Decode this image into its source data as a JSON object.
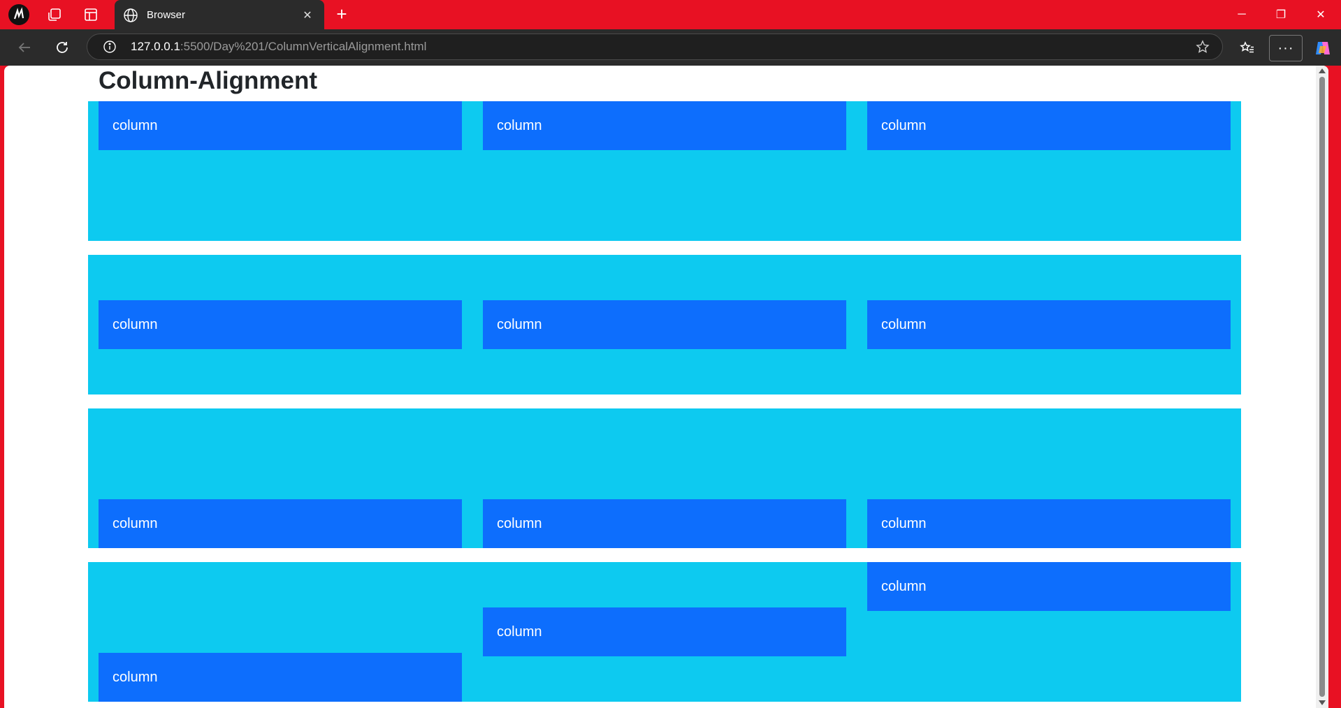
{
  "browser": {
    "tab_title": "Browser",
    "close_tab_glyph": "✕",
    "new_tab_glyph": "+",
    "url_host": "127.0.0.1",
    "url_rest": ":5500/Day%201/ColumnVerticalAlignment.html",
    "more_glyph": "···",
    "window": {
      "minimize": "─",
      "restore": "❐",
      "close": "✕"
    },
    "accent": "#e81123"
  },
  "page": {
    "heading": "Column-Alignment",
    "rows": [
      {
        "alignment": "start",
        "columns": [
          "column",
          "column",
          "column"
        ]
      },
      {
        "alignment": "center",
        "columns": [
          "column",
          "column",
          "column"
        ]
      },
      {
        "alignment": "end",
        "columns": [
          "column",
          "column",
          "column"
        ]
      },
      {
        "alignment": "mixed",
        "columns": [
          "column",
          "column",
          "column"
        ]
      }
    ],
    "colors": {
      "row_bg": "#0dcaf0",
      "col_bg": "#0d6efd"
    }
  }
}
